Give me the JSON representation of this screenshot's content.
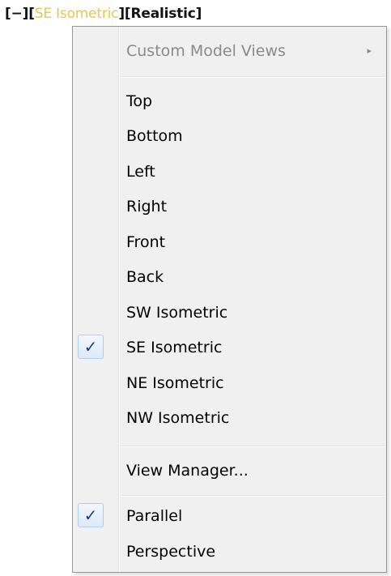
{
  "viewport_label": {
    "bracket_open_1": "[",
    "minus": "−",
    "bracket_close_1": "]",
    "bracket_open_2": "[",
    "view": "SE Isometric",
    "bracket_close_2": "]",
    "bracket_open_3": "[",
    "visual_style": "Realistic",
    "bracket_close_3": "]",
    "active_color": "#e8c64a"
  },
  "menu": {
    "custom_views": {
      "label": "Custom Model Views",
      "arrow": "▸"
    },
    "views": [
      {
        "label": "Top",
        "checked": false
      },
      {
        "label": "Bottom",
        "checked": false
      },
      {
        "label": "Left",
        "checked": false
      },
      {
        "label": "Right",
        "checked": false
      },
      {
        "label": "Front",
        "checked": false
      },
      {
        "label": "Back",
        "checked": false
      },
      {
        "label": "SW Isometric",
        "checked": false
      },
      {
        "label": "SE Isometric",
        "checked": true
      },
      {
        "label": "NE Isometric",
        "checked": false
      },
      {
        "label": "NW Isometric",
        "checked": false
      }
    ],
    "view_manager": {
      "label": "View Manager..."
    },
    "projection": [
      {
        "label": "Parallel",
        "checked": true
      },
      {
        "label": "Perspective",
        "checked": false
      }
    ],
    "check_glyph": "✓",
    "check_color": "#1a3f9a"
  }
}
